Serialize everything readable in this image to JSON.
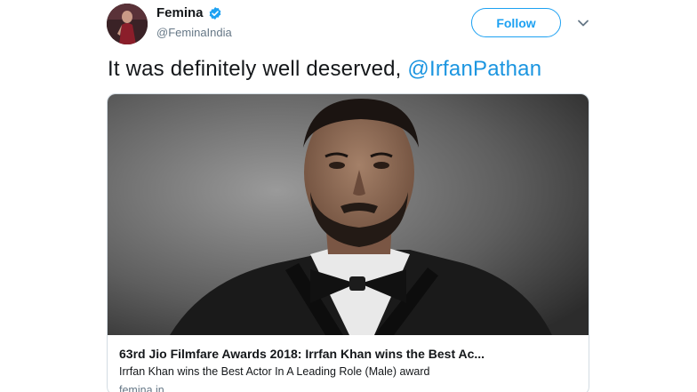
{
  "author": {
    "name": "Femina",
    "handle": "@FeminaIndia",
    "verified": true
  },
  "follow_label": "Follow",
  "tweet": {
    "text_prefix": "It was definitely well deserved, ",
    "mention": "@IrfanPathan"
  },
  "card": {
    "title": "63rd Jio Filmfare Awards 2018: Irrfan Khan wins the Best Ac...",
    "description": "Irrfan Khan wins the Best Actor In A Leading Role (Male) award",
    "domain": "femina.in"
  },
  "colors": {
    "accent": "#1da1f2",
    "mention": "#1b95e0",
    "text": "#14171a",
    "muted": "#657786"
  }
}
